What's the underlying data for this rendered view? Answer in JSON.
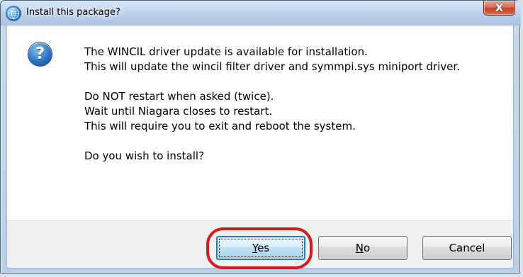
{
  "window": {
    "title": "Install this package?",
    "close_label": "X",
    "title_icon": "globe-icon",
    "question_icon": "question-icon"
  },
  "message": {
    "lines": [
      "The WINCIL driver update is available for installation.",
      "This will update the wincil filter driver and symmpi.sys miniport driver.",
      "Do NOT restart when asked (twice).",
      "Wait until Niagara closes to restart.",
      "This will require you to exit and reboot the system.",
      "Do you wish to install?"
    ]
  },
  "buttons": {
    "yes": {
      "underlined": "Y",
      "rest": "es"
    },
    "no": {
      "underlined": "N",
      "rest": "o"
    },
    "cancel": "Cancel"
  },
  "colors": {
    "annotation": "#d71a1e",
    "primary_button_border": "#1d7fcf"
  }
}
